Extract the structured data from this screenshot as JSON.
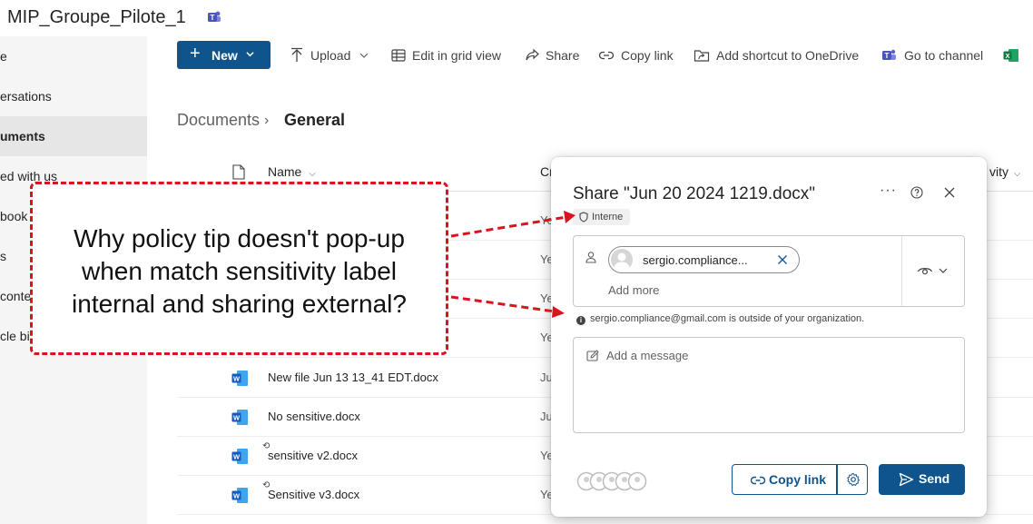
{
  "site": {
    "title": "MIP_Groupe_Pilote_1"
  },
  "nav": {
    "items": [
      {
        "label": "e"
      },
      {
        "label": "ersations"
      },
      {
        "label": "uments"
      },
      {
        "label": "ed with us"
      },
      {
        "label": "book"
      },
      {
        "label": "s"
      },
      {
        "label": "conte"
      },
      {
        "label": "cle bi"
      }
    ]
  },
  "toolbar": {
    "new_label": "New",
    "upload_label": "Upload",
    "grid_label": "Edit in grid view",
    "share_label": "Share",
    "copylink_label": "Copy link",
    "shortcut_label": "Add shortcut to OneDrive",
    "channel_label": "Go to channel"
  },
  "breadcrumb": {
    "root": "Documents",
    "separator": "›",
    "current": "General"
  },
  "columns": {
    "name": "Name",
    "modified_partial": "Cr",
    "activity_partial": "vity"
  },
  "files": [
    {
      "name": "",
      "modified": "Ye"
    },
    {
      "name": "",
      "modified": "Ye"
    },
    {
      "name": "",
      "modified": "Ye"
    },
    {
      "name": "",
      "modified": "Ye"
    },
    {
      "name": "New file Jun 13 13_41 EDT.docx",
      "modified": "Ju"
    },
    {
      "name": "No sensitive.docx",
      "modified": "Ju"
    },
    {
      "name": "sensitive v2.docx",
      "modified": "Ye"
    },
    {
      "name": "Sensitive v3.docx",
      "modified": "Ye"
    }
  ],
  "share_dialog": {
    "title": "Share \"Jun 20 2024 1219.docx\"",
    "more_label": "···",
    "sensitivity_label": "Interne",
    "recipient_chip": "sergio.compliance...",
    "add_more": "Add more",
    "external_warning": "sergio.compliance@gmail.com is outside of your organization.",
    "message_placeholder": "Add a message",
    "copy_link_label": "Copy link",
    "send_label": "Send"
  },
  "annotation": {
    "lines": [
      "Why policy tip doesn't pop-up",
      "when match sensitivity label",
      "internal and sharing external?"
    ],
    "color": "#d9141f"
  },
  "colors": {
    "accent": "#0f548c",
    "annotation": "#d9141f"
  }
}
